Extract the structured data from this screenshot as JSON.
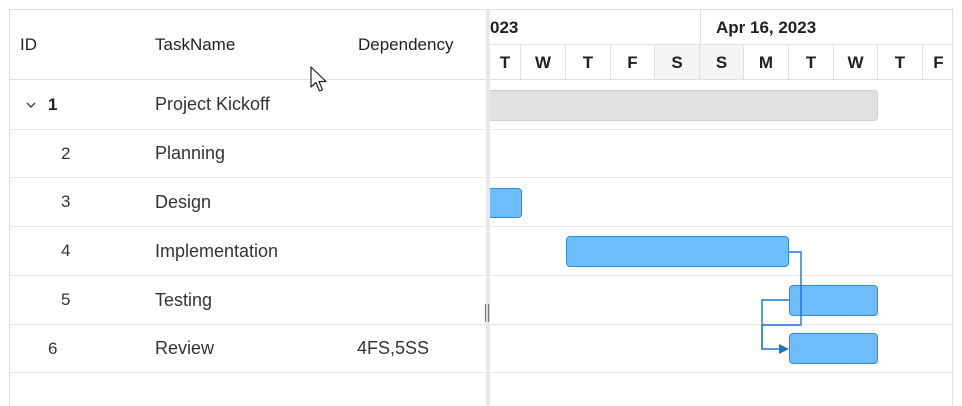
{
  "grid": {
    "columns": {
      "id": "ID",
      "task_name": "TaskName",
      "dependency": "Dependency"
    },
    "rows": [
      {
        "id": "1",
        "name": "Project Kickoff",
        "dependency": "",
        "parent": true,
        "expanded": true
      },
      {
        "id": "2",
        "name": "Planning",
        "dependency": ""
      },
      {
        "id": "3",
        "name": "Design",
        "dependency": ""
      },
      {
        "id": "4",
        "name": "Implementation",
        "dependency": ""
      },
      {
        "id": "5",
        "name": "Testing",
        "dependency": ""
      },
      {
        "id": "6",
        "name": "Review",
        "dependency": "4FS,5SS"
      }
    ]
  },
  "timeline": {
    "weeks": [
      {
        "label": "023"
      },
      {
        "label": "Apr 16, 2023"
      }
    ],
    "days": [
      {
        "label": "T",
        "weekend": false
      },
      {
        "label": "W",
        "weekend": false
      },
      {
        "label": "T",
        "weekend": false
      },
      {
        "label": "F",
        "weekend": false
      },
      {
        "label": "S",
        "weekend": true
      },
      {
        "label": "S",
        "weekend": true
      },
      {
        "label": "M",
        "weekend": false
      },
      {
        "label": "T",
        "weekend": false
      },
      {
        "label": "W",
        "weekend": false
      },
      {
        "label": "T",
        "weekend": false
      },
      {
        "label": "F",
        "weekend": false
      }
    ]
  },
  "colors": {
    "task_bar": "#6dbdfc",
    "task_border": "#2c8de0",
    "parent_bar": "#e0e0e0",
    "connector": "#1976d2"
  },
  "icons": {
    "expand": "chevron-down-icon",
    "pointer": "mouse-pointer-icon",
    "splitter": "splitter-grip-icon"
  }
}
